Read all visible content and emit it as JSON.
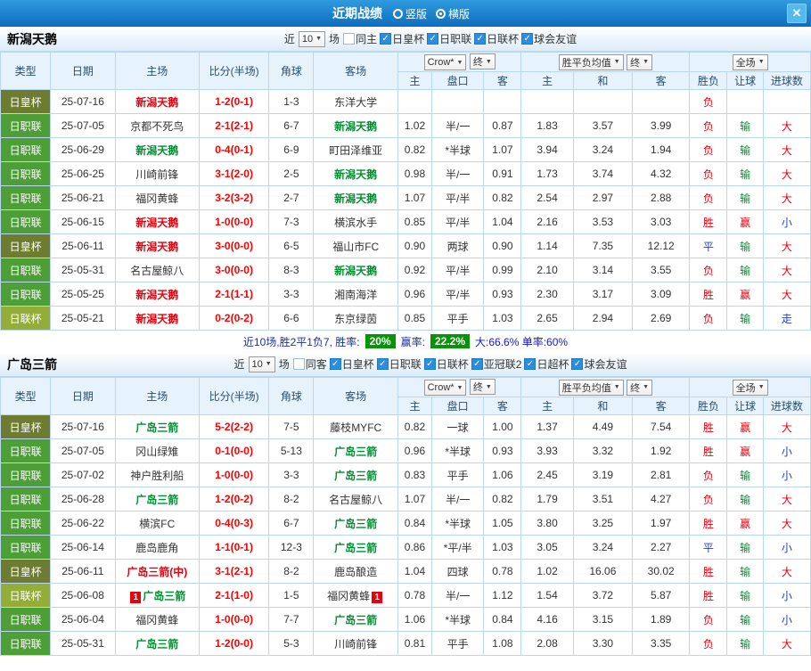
{
  "titlebar": {
    "title": "近期战绩",
    "layout_options": [
      {
        "label": "竖版",
        "selected": false
      },
      {
        "label": "横版",
        "selected": true
      }
    ],
    "close_label": "✕"
  },
  "controls": {
    "recent_label": "近",
    "recent_value": "10",
    "matches_label": "场",
    "bookmaker": "Crow*",
    "final_label": "终",
    "avg_label": "胜平负均值",
    "scope_label": "全场"
  },
  "columns": {
    "type": "类型",
    "date": "日期",
    "home": "主场",
    "score": "比分(半场)",
    "corner": "角球",
    "away": "客场",
    "odds_home": "主",
    "handicap": "盘口",
    "odds_away": "客",
    "avg_home": "主",
    "avg_draw": "和",
    "avg_away": "客",
    "result": "胜负",
    "handicap_result": "让球",
    "goals": "进球数"
  },
  "colors": {
    "cup_green": "#6e7c31",
    "league_green": "#4d9e37",
    "levain_green": "#94ad39",
    "red": "#e8000d",
    "green": "#009030",
    "blue": "#2242c8",
    "badge_green": "#089408"
  },
  "sections": [
    {
      "team": "新潟天鹅",
      "filters": [
        {
          "label": "同主",
          "checked": false
        },
        {
          "label": "日皇杯",
          "checked": true
        },
        {
          "label": "日职联",
          "checked": true
        },
        {
          "label": "日联杯",
          "checked": true
        },
        {
          "label": "球会友谊",
          "checked": true
        }
      ],
      "rows": [
        {
          "type": "日皇杯",
          "k": "cup",
          "cells": [
            "25-07-16",
            {
              "t": "新潟天鹅",
              "c": "tm-red"
            },
            {
              "t": "1-2(0-1)",
              "c": "score"
            },
            "1-3",
            "东洋大学",
            "",
            "",
            "",
            "",
            "",
            "",
            {
              "t": "负",
              "c": "t-red"
            },
            "",
            ""
          ]
        },
        {
          "type": "日职联",
          "k": "j1",
          "cells": [
            "25-07-05",
            "京都不死鸟",
            {
              "t": "2-1(2-1)",
              "c": "score"
            },
            "6-7",
            {
              "t": "新潟天鹅",
              "c": "tm-green"
            },
            "1.02",
            "半/一",
            "0.87",
            "1.83",
            "3.57",
            "3.99",
            {
              "t": "负",
              "c": "t-red"
            },
            {
              "t": "输",
              "c": "t-green"
            },
            {
              "t": "大",
              "c": "t-red"
            }
          ]
        },
        {
          "type": "日职联",
          "k": "j1",
          "cells": [
            "25-06-29",
            {
              "t": "新潟天鹅",
              "c": "tm-green"
            },
            {
              "t": "0-4(0-1)",
              "c": "score"
            },
            "6-9",
            "町田泽维亚",
            "0.82",
            "*半球",
            "1.07",
            "3.94",
            "3.24",
            "1.94",
            {
              "t": "负",
              "c": "t-red"
            },
            {
              "t": "输",
              "c": "t-green"
            },
            {
              "t": "大",
              "c": "t-red"
            }
          ]
        },
        {
          "type": "日职联",
          "k": "j1",
          "cells": [
            "25-06-25",
            "川崎前锋",
            {
              "t": "3-1(2-0)",
              "c": "score"
            },
            "2-5",
            {
              "t": "新潟天鹅",
              "c": "tm-green"
            },
            "0.98",
            "半/一",
            "0.91",
            "1.73",
            "3.74",
            "4.32",
            {
              "t": "负",
              "c": "t-red"
            },
            {
              "t": "输",
              "c": "t-green"
            },
            {
              "t": "大",
              "c": "t-red"
            }
          ]
        },
        {
          "type": "日职联",
          "k": "j1",
          "cells": [
            "25-06-21",
            "福冈黄蜂",
            {
              "t": "3-2(3-2)",
              "c": "score"
            },
            "2-7",
            {
              "t": "新潟天鹅",
              "c": "tm-green"
            },
            "1.07",
            "平/半",
            "0.82",
            "2.54",
            "2.97",
            "2.88",
            {
              "t": "负",
              "c": "t-red"
            },
            {
              "t": "输",
              "c": "t-green"
            },
            {
              "t": "大",
              "c": "t-red"
            }
          ]
        },
        {
          "type": "日职联",
          "k": "j1",
          "cells": [
            "25-06-15",
            {
              "t": "新潟天鹅",
              "c": "tm-red"
            },
            {
              "t": "1-0(0-0)",
              "c": "score"
            },
            "7-3",
            "横滨水手",
            "0.85",
            "平/半",
            "1.04",
            "2.16",
            "3.53",
            "3.03",
            {
              "t": "胜",
              "c": "t-red"
            },
            {
              "t": "赢",
              "c": "t-red"
            },
            {
              "t": "小",
              "c": "t-blue"
            }
          ]
        },
        {
          "type": "日皇杯",
          "k": "cup",
          "cells": [
            "25-06-11",
            {
              "t": "新潟天鹅",
              "c": "tm-red"
            },
            {
              "t": "3-0(0-0)",
              "c": "score"
            },
            "6-5",
            "福山市FC",
            "0.90",
            "两球",
            "0.90",
            "1.14",
            "7.35",
            "12.12",
            {
              "t": "平",
              "c": "t-blue"
            },
            {
              "t": "输",
              "c": "t-green"
            },
            {
              "t": "大",
              "c": "t-red"
            }
          ]
        },
        {
          "type": "日职联",
          "k": "j1",
          "cells": [
            "25-05-31",
            "名古屋鲸八",
            {
              "t": "3-0(0-0)",
              "c": "score"
            },
            "8-3",
            {
              "t": "新潟天鹅",
              "c": "tm-green"
            },
            "0.92",
            "平/半",
            "0.99",
            "2.10",
            "3.14",
            "3.55",
            {
              "t": "负",
              "c": "t-red"
            },
            {
              "t": "输",
              "c": "t-green"
            },
            {
              "t": "大",
              "c": "t-red"
            }
          ]
        },
        {
          "type": "日职联",
          "k": "j1",
          "cells": [
            "25-05-25",
            {
              "t": "新潟天鹅",
              "c": "tm-red"
            },
            {
              "t": "2-1(1-1)",
              "c": "score"
            },
            "3-3",
            "湘南海洋",
            "0.96",
            "平/半",
            "0.93",
            "2.30",
            "3.17",
            "3.09",
            {
              "t": "胜",
              "c": "t-red"
            },
            {
              "t": "赢",
              "c": "t-red"
            },
            {
              "t": "大",
              "c": "t-red"
            }
          ]
        },
        {
          "type": "日联杯",
          "k": "lc",
          "cells": [
            "25-05-21",
            {
              "t": "新潟天鹅",
              "c": "tm-red"
            },
            {
              "t": "0-2(0-2)",
              "c": "score"
            },
            "6-6",
            "东京绿茵",
            "0.85",
            "平手",
            "1.03",
            "2.65",
            "2.94",
            "2.69",
            {
              "t": "负",
              "c": "t-red"
            },
            {
              "t": "输",
              "c": "t-green"
            },
            {
              "t": "走",
              "c": "t-blue"
            }
          ]
        }
      ],
      "summary": {
        "prefix": "近10场,胜2平1负7, 胜率:",
        "win_rate": "20%",
        "mid_label": "赢率:",
        "profit_rate": "22.2%",
        "tail": "大:66.6% 单率:60%"
      }
    },
    {
      "team": "广岛三箭",
      "filters": [
        {
          "label": "同客",
          "checked": false
        },
        {
          "label": "日皇杯",
          "checked": true
        },
        {
          "label": "日职联",
          "checked": true
        },
        {
          "label": "日联杯",
          "checked": true
        },
        {
          "label": "亚冠联2",
          "checked": true
        },
        {
          "label": "日超杯",
          "checked": true
        },
        {
          "label": "球会友谊",
          "checked": true
        }
      ],
      "rows": [
        {
          "type": "日皇杯",
          "k": "cup",
          "cells": [
            "25-07-16",
            {
              "t": "广岛三箭",
              "c": "tm-green"
            },
            {
              "t": "5-2(2-2)",
              "c": "score"
            },
            "7-5",
            "藤枝MYFC",
            "0.82",
            "一球",
            "1.00",
            "1.37",
            "4.49",
            "7.54",
            {
              "t": "胜",
              "c": "t-red"
            },
            {
              "t": "赢",
              "c": "t-red"
            },
            {
              "t": "大",
              "c": "t-red"
            }
          ]
        },
        {
          "type": "日职联",
          "k": "j1",
          "cells": [
            "25-07-05",
            "冈山绿雉",
            {
              "t": "0-1(0-0)",
              "c": "score"
            },
            "5-13",
            {
              "t": "广岛三箭",
              "c": "tm-green"
            },
            "0.96",
            "*半球",
            "0.93",
            "3.93",
            "3.32",
            "1.92",
            {
              "t": "胜",
              "c": "t-red"
            },
            {
              "t": "赢",
              "c": "t-red"
            },
            {
              "t": "小",
              "c": "t-blue"
            }
          ]
        },
        {
          "type": "日职联",
          "k": "j1",
          "cells": [
            "25-07-02",
            "神户胜利船",
            {
              "t": "1-0(0-0)",
              "c": "score"
            },
            "3-3",
            {
              "t": "广岛三箭",
              "c": "tm-green"
            },
            "0.83",
            "平手",
            "1.06",
            "2.45",
            "3.19",
            "2.81",
            {
              "t": "负",
              "c": "t-red"
            },
            {
              "t": "输",
              "c": "t-green"
            },
            {
              "t": "小",
              "c": "t-blue"
            }
          ]
        },
        {
          "type": "日职联",
          "k": "j1",
          "cells": [
            "25-06-28",
            {
              "t": "广岛三箭",
              "c": "tm-green"
            },
            {
              "t": "1-2(0-2)",
              "c": "score"
            },
            "8-2",
            "名古屋鲸八",
            "1.07",
            "半/一",
            "0.82",
            "1.79",
            "3.51",
            "4.27",
            {
              "t": "负",
              "c": "t-red"
            },
            {
              "t": "输",
              "c": "t-green"
            },
            {
              "t": "大",
              "c": "t-red"
            }
          ]
        },
        {
          "type": "日职联",
          "k": "j1",
          "cells": [
            "25-06-22",
            "横滨FC",
            {
              "t": "0-4(0-3)",
              "c": "score"
            },
            "6-7",
            {
              "t": "广岛三箭",
              "c": "tm-green"
            },
            "0.84",
            "*半球",
            "1.05",
            "3.80",
            "3.25",
            "1.97",
            {
              "t": "胜",
              "c": "t-red"
            },
            {
              "t": "赢",
              "c": "t-red"
            },
            {
              "t": "大",
              "c": "t-red"
            }
          ]
        },
        {
          "type": "日职联",
          "k": "j1",
          "cells": [
            "25-06-14",
            "鹿岛鹿角",
            {
              "t": "1-1(0-1)",
              "c": "score"
            },
            "12-3",
            {
              "t": "广岛三箭",
              "c": "tm-green"
            },
            "0.86",
            "*平/半",
            "1.03",
            "3.05",
            "3.24",
            "2.27",
            {
              "t": "平",
              "c": "t-blue"
            },
            {
              "t": "输",
              "c": "t-green"
            },
            {
              "t": "小",
              "c": "t-blue"
            }
          ]
        },
        {
          "type": "日皇杯",
          "k": "cup",
          "cells": [
            "25-06-11",
            {
              "t": "广岛三箭(中)",
              "c": "tm-red"
            },
            {
              "t": "3-1(2-1)",
              "c": "score"
            },
            "8-2",
            "鹿岛酿造",
            "1.04",
            "四球",
            "0.78",
            "1.02",
            "16.06",
            "30.02",
            {
              "t": "胜",
              "c": "t-red"
            },
            {
              "t": "输",
              "c": "t-green"
            },
            {
              "t": "大",
              "c": "t-red"
            }
          ]
        },
        {
          "type": "日联杯",
          "k": "lc",
          "cells": [
            "25-06-08",
            {
              "t": "广岛三箭",
              "c": "tm-green",
              "pb": "1"
            },
            {
              "t": "2-1(1-0)",
              "c": "score"
            },
            "1-5",
            {
              "t": "福冈黄蜂",
              "sb": "1"
            },
            "0.78",
            "半/一",
            "1.12",
            "1.54",
            "3.72",
            "5.87",
            {
              "t": "胜",
              "c": "t-red"
            },
            {
              "t": "输",
              "c": "t-green"
            },
            {
              "t": "小",
              "c": "t-blue"
            }
          ]
        },
        {
          "type": "日职联",
          "k": "j1",
          "cells": [
            "25-06-04",
            "福冈黄蜂",
            {
              "t": "1-0(0-0)",
              "c": "score"
            },
            "7-7",
            {
              "t": "广岛三箭",
              "c": "tm-green"
            },
            "1.06",
            "*半球",
            "0.84",
            "4.16",
            "3.15",
            "1.89",
            {
              "t": "负",
              "c": "t-red"
            },
            {
              "t": "输",
              "c": "t-green"
            },
            {
              "t": "小",
              "c": "t-blue"
            }
          ]
        },
        {
          "type": "日职联",
          "k": "j1",
          "cells": [
            "25-05-31",
            {
              "t": "广岛三箭",
              "c": "tm-green"
            },
            {
              "t": "1-2(0-0)",
              "c": "score"
            },
            "5-3",
            "川崎前锋",
            "0.81",
            "平手",
            "1.08",
            "2.08",
            "3.30",
            "3.35",
            {
              "t": "负",
              "c": "t-red"
            },
            {
              "t": "输",
              "c": "t-green"
            },
            {
              "t": "大",
              "c": "t-red"
            }
          ]
        }
      ],
      "summary": null
    }
  ]
}
